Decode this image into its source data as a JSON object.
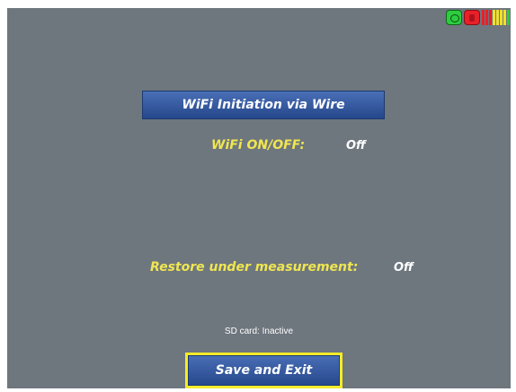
{
  "header": {
    "title_button": "WiFi Initiation via Wire"
  },
  "status_icons": {
    "left_icon": "gps-status-icon",
    "left_color": "#2ecc40",
    "middle_icon": "recording-status-icon",
    "middle_color": "#e8202a",
    "level_meter_icon": "signal-level-icon",
    "level_colors": [
      "#e8202a",
      "#e8202a",
      "#e8202a",
      "#f2e02a",
      "#f2e02a",
      "#f2e02a",
      "#f2e02a",
      "#2ecc40"
    ]
  },
  "settings": {
    "wifi": {
      "label": "WiFi ON/OFF:",
      "value": "Off"
    },
    "restore": {
      "label": "Restore under measurement:",
      "value": "Off"
    }
  },
  "sd_card": {
    "status_text": "SD card: Inactive"
  },
  "footer": {
    "save_exit_label": "Save and Exit"
  },
  "colors": {
    "background": "#6e767e",
    "label_yellow": "#f0e650",
    "button_blue": "#2f57a0",
    "focus_yellow": "#f4ec2a"
  }
}
